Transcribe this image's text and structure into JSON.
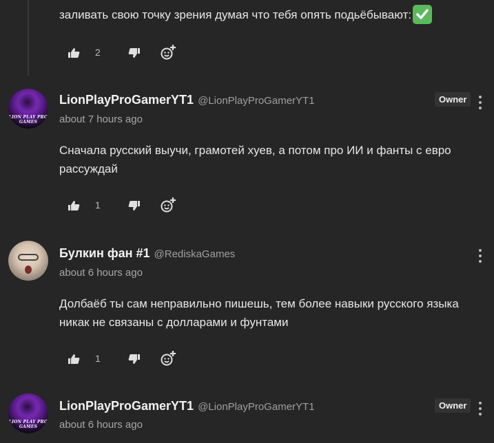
{
  "comments": [
    {
      "text": "заливать свою точку зрения думая что тебя опять подьёбывают:",
      "emoji": "check-mark-emoji",
      "likes": "2"
    },
    {
      "author": "LionPlayProGamerYT1",
      "handle": "@LionPlayProGamerYT1",
      "time": "about 7 hours ago",
      "badge": "Owner",
      "avatar_text": "LION PLAY PRO GAMES",
      "text": "Сначала русский выучи, грамотей хуев, а потом про ИИ и фанты с евро рассуждай",
      "likes": "1"
    },
    {
      "author": "Булкин фан #1",
      "handle": "@RediskaGames",
      "time": "about 6 hours ago",
      "text": "Долбаёб ты сам неправильно пишешь, тем более навыки русского языка никак не связаны с долларами и фунтами",
      "likes": "1"
    },
    {
      "author": "LionPlayProGamerYT1",
      "handle": "@LionPlayProGamerYT1",
      "time": "about 6 hours ago",
      "badge": "Owner",
      "avatar_text": "LION PLAY PRO GAMES"
    }
  ],
  "colors": {
    "background": "#262626",
    "text": "#e8e8e8",
    "muted": "#a8a8a8",
    "owner_badge_bg": "#333333"
  }
}
